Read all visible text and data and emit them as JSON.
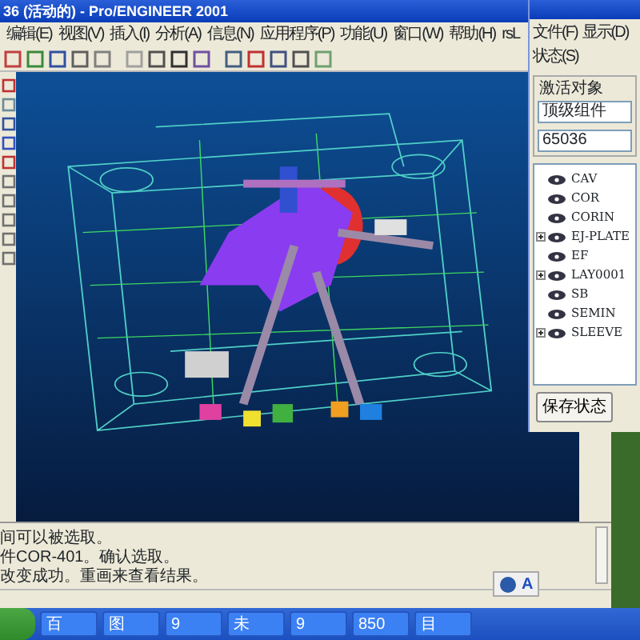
{
  "main_window": {
    "title": "36 (活动的) - Pro/ENGINEER 2001",
    "menu": [
      "编辑(E)",
      "视图(V)",
      "插入(I)",
      "分析(A)",
      "信息(N)",
      "应用程序(P)",
      "功能(U)",
      "窗口(W)",
      "帮助(H)",
      "rsL"
    ],
    "messages": [
      "间可以被选取。",
      "件COR-401。确认选取。",
      "改变成功。重画来查看结果。"
    ]
  },
  "model_tree_window": {
    "menu": [
      "文件(F)",
      "显示(D)",
      "状态(S)"
    ],
    "group_label": "激活对象",
    "active_object": "顶级组件",
    "field_value": "65036",
    "items": [
      {
        "label": "CAV",
        "expandable": false
      },
      {
        "label": "COR",
        "expandable": false
      },
      {
        "label": "CORIN",
        "expandable": false
      },
      {
        "label": "EJ-PLATE",
        "expandable": true
      },
      {
        "label": "EF",
        "expandable": false
      },
      {
        "label": "LAY0001",
        "expandable": true
      },
      {
        "label": "SB",
        "expandable": false
      },
      {
        "label": "SEMIN",
        "expandable": false
      },
      {
        "label": "SLEEVE",
        "expandable": true
      }
    ],
    "save_button": "保存状态"
  },
  "language_bar": {
    "label": "A"
  },
  "taskbar": {
    "buttons": [
      "百",
      "图",
      "9",
      "未",
      "9",
      "850",
      "目"
    ]
  }
}
